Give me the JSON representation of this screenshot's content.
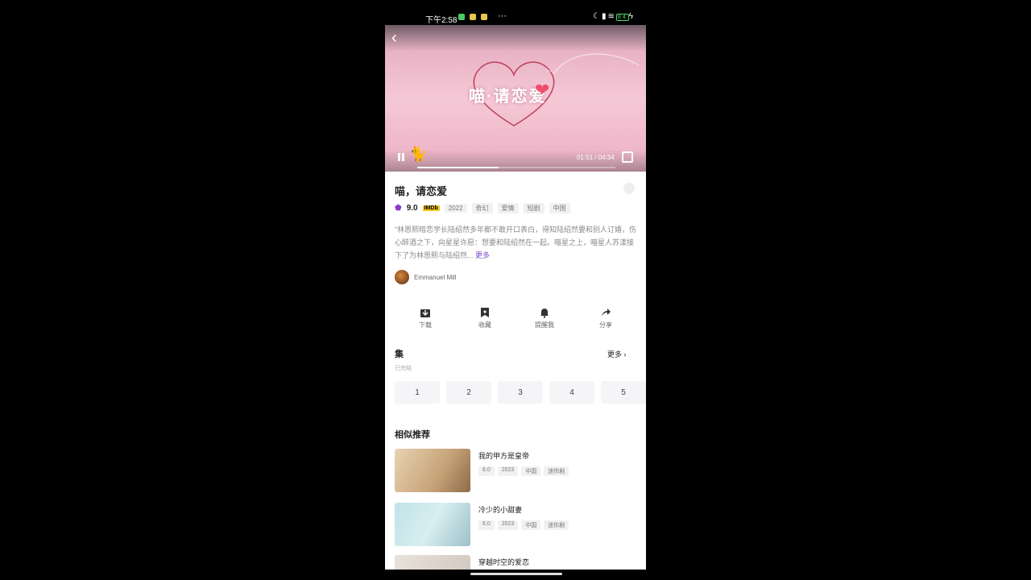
{
  "status": {
    "time": "下午2:58",
    "dots": "···",
    "battery": "84"
  },
  "video": {
    "art_text": "喵·请恋爱",
    "timecode": "01:51 / 04:34",
    "progress_fraction": 0.41
  },
  "info": {
    "title": "喵，请恋爱",
    "score": "9.0",
    "imdb": "IMDb",
    "tags": [
      "2022",
      "奇幻",
      "爱情",
      "短剧",
      "中国"
    ],
    "summary": "“林恩熙暗恋学长陆绍然多年都不敢开口表白，得知陆绍然要和别人订婚，伤心醉酒之下，向星星许愿：想要和陆绍然在一起。喵星之上，喵星人苏漾接下了为林恩熙与陆绍然...",
    "more": "更多",
    "cast_name": "Emmanuel Mill"
  },
  "actions": [
    {
      "label": "下载"
    },
    {
      "label": "收藏"
    },
    {
      "label": "提醒我"
    },
    {
      "label": "分享"
    }
  ],
  "episodes": {
    "heading": "集",
    "more": "更多",
    "status": "已完结",
    "items": [
      "1",
      "2",
      "3",
      "4",
      "5"
    ]
  },
  "recommend": {
    "heading": "相似推荐",
    "items": [
      {
        "name": "我的甲方是皇帝",
        "score": "6.0",
        "tags": [
          "2023",
          "中国",
          "迷你剧"
        ]
      },
      {
        "name": "冷少的小甜妻",
        "score": "6.0",
        "tags": [
          "2023",
          "中国",
          "迷你剧"
        ]
      },
      {
        "name": "穿越时空的爱恋",
        "score": "",
        "tags": []
      }
    ]
  },
  "colors": {
    "accent": "#7a4bc9",
    "video_pink": "#f5c8d6"
  }
}
